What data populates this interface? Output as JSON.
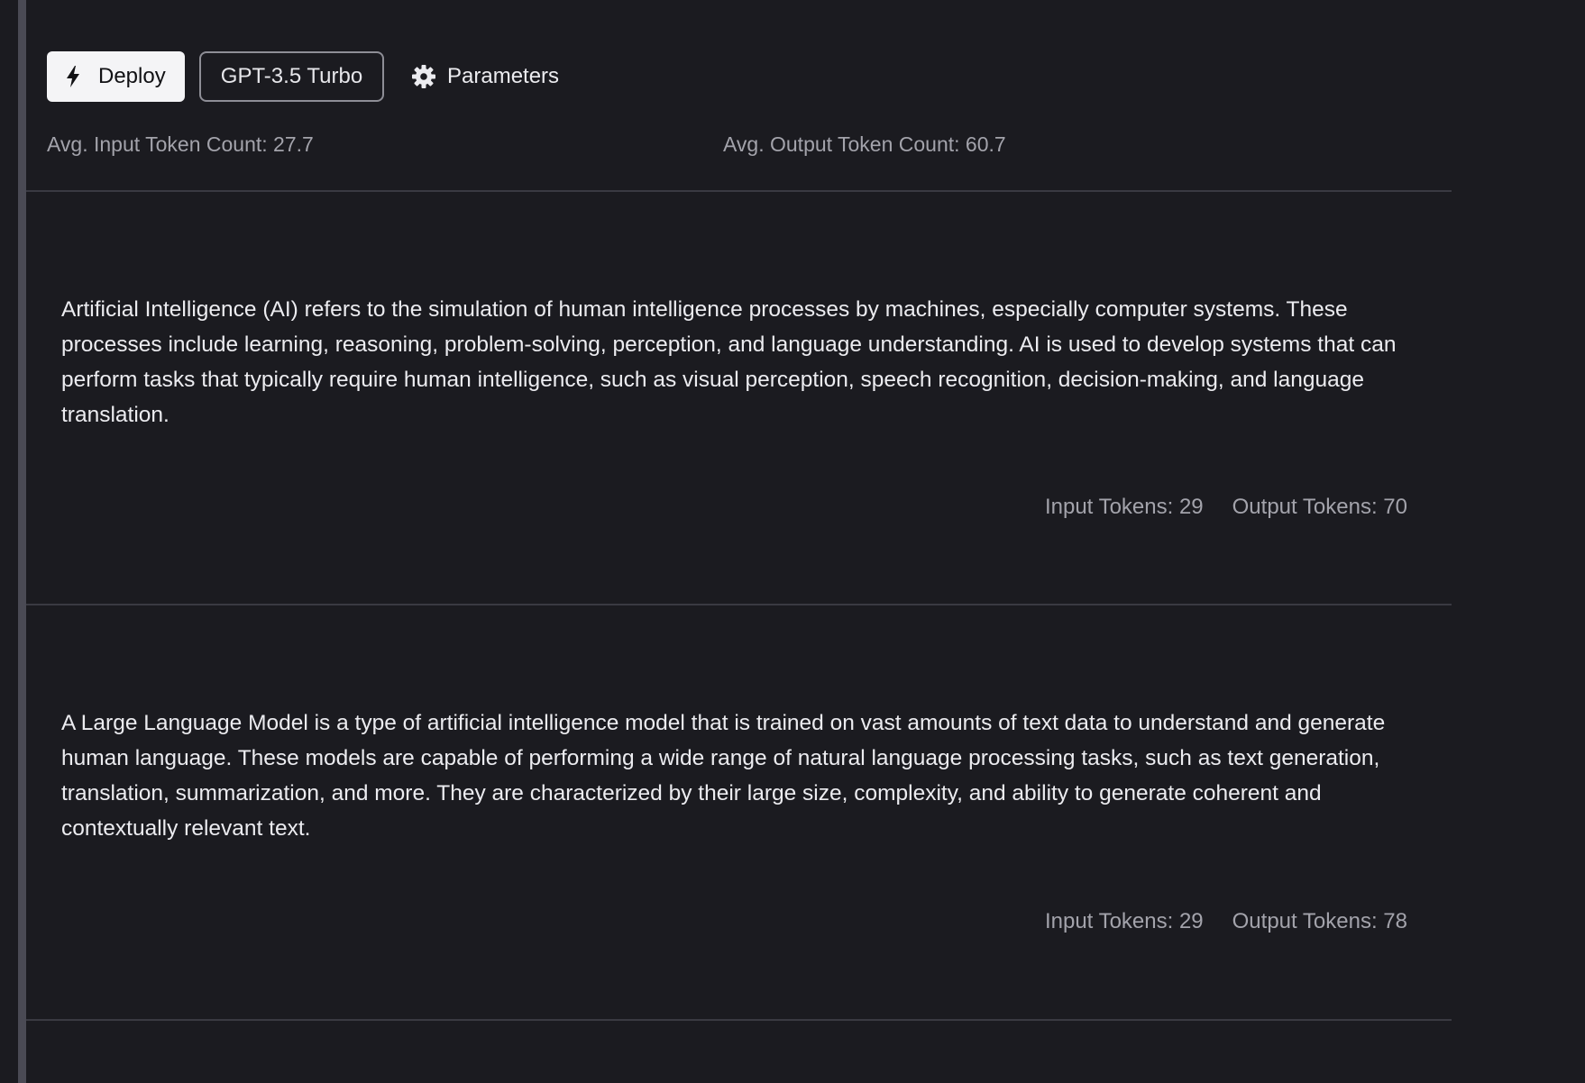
{
  "toolbar": {
    "deploy_label": "Deploy",
    "deploy_icon": "lightning-bolt-icon",
    "model_label": "GPT-3.5 Turbo",
    "parameters_label": "Parameters",
    "parameters_icon": "gear-icon"
  },
  "stats": {
    "avg_input": "Avg. Input Token Count: 27.7",
    "avg_output": "Avg. Output Token Count: 60.7"
  },
  "responses": [
    {
      "text": "Artificial Intelligence (AI) refers to the simulation of human intelligence processes by machines, especially computer systems. These processes include learning, reasoning, problem-solving, perception, and language understanding. AI is used to develop systems that can perform tasks that typically require human intelligence, such as visual perception, speech recognition, decision-making, and language translation.",
      "input_tokens": "Input Tokens: 29",
      "output_tokens": "Output Tokens: 70"
    },
    {
      "text": "A Large Language Model is a type of artificial intelligence model that is trained on vast amounts of text data to understand and generate human language. These models are capable of performing a wide range of natural language processing tasks, such as text generation, translation, summarization, and more. They are characterized by their large size, complexity, and ability to generate coherent and contextually relevant text.",
      "input_tokens": "Input Tokens: 29",
      "output_tokens": "Output Tokens: 78"
    }
  ],
  "colors": {
    "background": "#1b1b20",
    "primary_button": "#f4f4f6",
    "muted_text": "#a3a3ab",
    "divider": "#3a3a42"
  }
}
